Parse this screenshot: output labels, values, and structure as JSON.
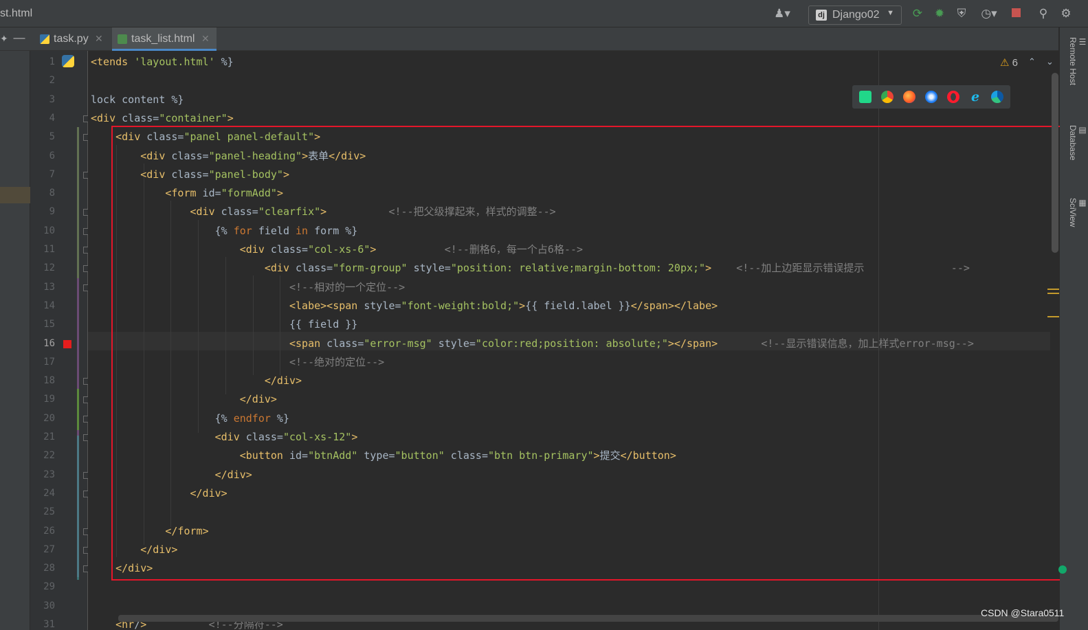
{
  "window": {
    "title": "st.html"
  },
  "toolbar": {
    "run_config": "Django02",
    "icons": [
      "user-icon",
      "rerun-icon",
      "debug-icon",
      "coverage-icon",
      "profile-icon",
      "stop-icon",
      "search-icon",
      "settings-icon"
    ]
  },
  "tabs": [
    {
      "label": "task.py",
      "active": false
    },
    {
      "label": "task_list.html",
      "active": true
    }
  ],
  "editor": {
    "warnings_count": "6",
    "current_line": "16",
    "line_numbers": [
      "1",
      "2",
      "3",
      "4",
      "5",
      "6",
      "7",
      "8",
      "9",
      "10",
      "11",
      "12",
      "13",
      "14",
      "15",
      "16",
      "17",
      "18",
      "19",
      "20",
      "21",
      "22",
      "23",
      "24",
      "25",
      "26",
      "27",
      "28",
      "29",
      "30",
      "31"
    ],
    "lines": [
      "<tends 'layout.html' %}",
      "",
      "lock content %}",
      "<div class=\"container\">",
      "    <div class=\"panel panel-default\">",
      "        <div class=\"panel-heading\">表单</div>",
      "        <div class=\"panel-body\">",
      "            <form id=\"formAdd\">",
      "                <div class=\"clearfix\">          <!--把父级撑起来，样式的调整-->",
      "                    {% for field in form %}",
      "                        <div class=\"col-xs-6\">           <!--删格6，每一个占6格-->",
      "                            <div class=\"form-group\" style=\"position: relative;margin-bottom: 20px;\">    <!--加上边距显示错误提示              -->",
      "                                <!--相对的一个定位-->",
      "                                <labe><span style=\"font-weight:bold;\">{{ field.label }}</span></labe>",
      "                                {{ field }}",
      "                                <span class=\"error-msg\" style=\"color:red;position: absolute;\"></span>       <!--显示错误信息，加上样式error-msg-->",
      "                                <!--绝对的定位-->",
      "                            </div>",
      "                        </div>",
      "                    {% endfor %}",
      "                    <div class=\"col-xs-12\">",
      "                        <button id=\"btnAdd\" type=\"button\" class=\"btn btn-primary\">提交</button>",
      "                    </div>",
      "                </div>",
      "",
      "            </form>",
      "        </div>",
      "    </div>",
      "",
      "",
      "    <hr/>          <!--分隔符-->"
    ]
  },
  "browsers": [
    "pycharm-icon",
    "chrome-icon",
    "firefox-icon",
    "safari-icon",
    "opera-icon",
    "ie-icon",
    "edge-icon"
  ],
  "right_panels": [
    "Remote Host",
    "Database",
    "SciView"
  ],
  "colors": {
    "accent": "#4a88c7",
    "selection_box": "#e5162a",
    "breakpoint": "#e51d1d"
  },
  "watermark": "CSDN @Stara0511"
}
